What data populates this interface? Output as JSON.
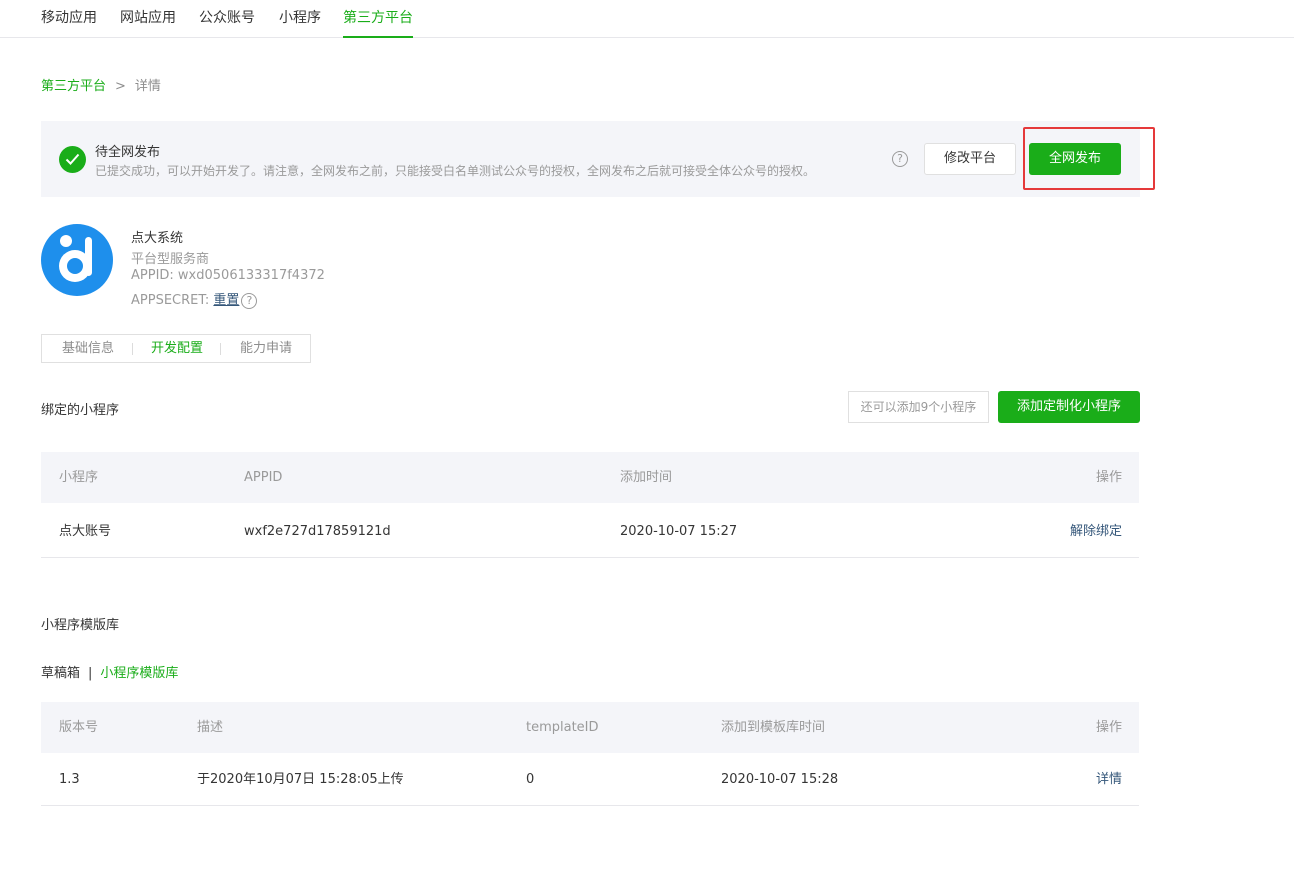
{
  "nav": {
    "tabs": [
      {
        "label": "移动应用"
      },
      {
        "label": "网站应用"
      },
      {
        "label": "公众账号"
      },
      {
        "label": "小程序"
      },
      {
        "label": "第三方平台"
      }
    ],
    "active_index": 4
  },
  "breadcrumb": {
    "parent": "第三方平台",
    "separator": ">",
    "current": "详情"
  },
  "status": {
    "title": "待全网发布",
    "description": "已提交成功，可以开始开发了。请注意，全网发布之前，只能接受白名单测试公众号的授权，全网发布之后就可接受全体公众号的授权。",
    "help_glyph": "?",
    "edit_button": "修改平台",
    "publish_button": "全网发布"
  },
  "platform": {
    "name": "点大系统",
    "type": "平台型服务商",
    "appid": "APPID: wxd0506133317f4372",
    "secret_label": "APPSECRET:",
    "secret_reset": "重置",
    "help_glyph": "?"
  },
  "subtabs": {
    "items": [
      {
        "label": "基础信息"
      },
      {
        "label": "开发配置"
      },
      {
        "label": "能力申请"
      }
    ],
    "active_index": 1
  },
  "bound": {
    "title": "绑定的小程序",
    "quota_text": "还可以添加9个小程序",
    "add_button": "添加定制化小程序",
    "columns": [
      "小程序",
      "APPID",
      "添加时间",
      "操作"
    ],
    "rows": [
      {
        "name": "点大账号",
        "appid": "wxf2e727d17859121d",
        "time": "2020-10-07 15:27",
        "action": "解除绑定"
      }
    ]
  },
  "templates": {
    "title": "小程序模版库",
    "tabs": [
      {
        "label": "草稿箱"
      },
      {
        "label": "小程序模版库"
      }
    ],
    "tab_separator": "|",
    "active_tab_index": 1,
    "columns": [
      "版本号",
      "描述",
      "templateID",
      "添加到模板库时间",
      "操作"
    ],
    "rows": [
      {
        "version": "1.3",
        "description": "于2020年10月07日 15:28:05上传",
        "template_id": "0",
        "time": "2020-10-07 15:28",
        "action": "详情"
      }
    ]
  },
  "colors": {
    "accent": "#1aad19",
    "highlight": "#e5393a",
    "link": "#35577a",
    "logo": "#1e8fec"
  }
}
